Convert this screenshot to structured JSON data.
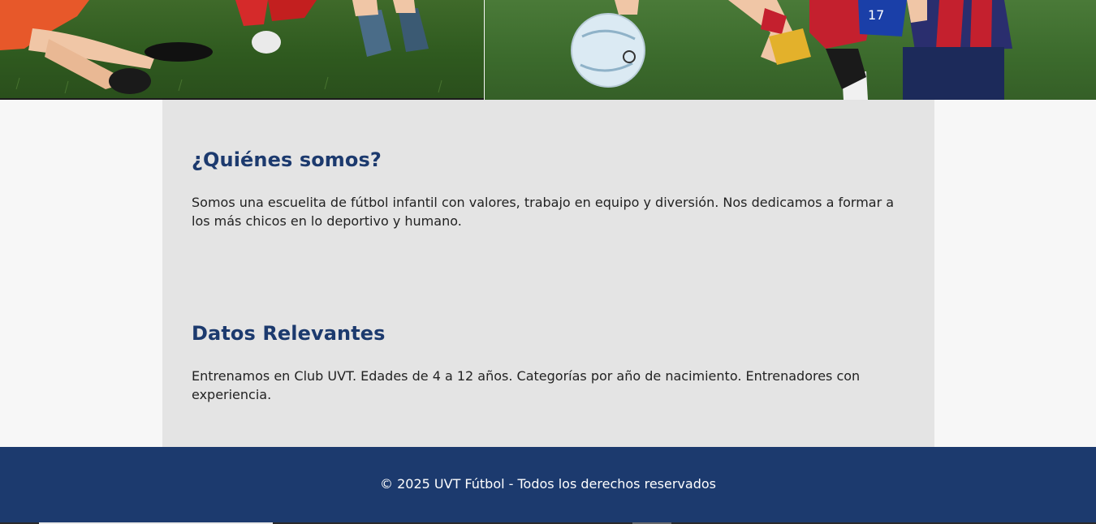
{
  "hero": {
    "left_image": "kids-sitting-on-grass-photo",
    "right_image": "kids-playing-soccer-photo"
  },
  "sections": [
    {
      "title": "¿Quiénes somos?",
      "text": "Somos una escuelita de fútbol infantil con valores, trabajo en equipo y diversión. Nos dedicamos a formar a los más chicos en lo deportivo y humano."
    },
    {
      "title": "Datos Relevantes",
      "text": "Entrenamos en Club UVT. Edades de 4 a 12 años. Categorías por año de nacimiento. Entrenadores con experiencia."
    }
  ],
  "footer": {
    "text": "© 2025 UVT Fútbol - Todos los derechos reservados"
  },
  "colors": {
    "accent": "#1c3a6e",
    "card_bg": "#e4e4e4",
    "page_bg": "#f7f7f7"
  }
}
